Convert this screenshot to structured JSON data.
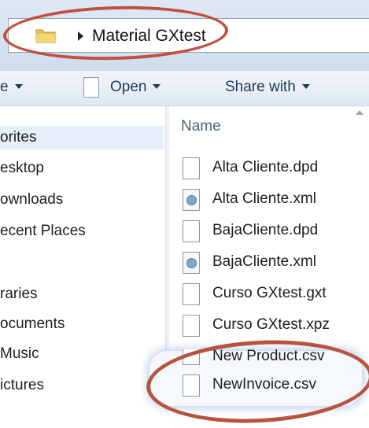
{
  "address_bar": {
    "breadcrumb": "Material GXtest"
  },
  "toolbar": {
    "organize_label": "e",
    "open_label": "Open",
    "share_label": "Share with"
  },
  "nav": {
    "items": [
      {
        "label": "orites"
      },
      {
        "label": "esktop"
      },
      {
        "label": "ownloads"
      },
      {
        "label": "ecent Places"
      },
      {
        "label": "raries"
      },
      {
        "label": "ocuments"
      },
      {
        "label": "Music"
      },
      {
        "label": "ictures"
      }
    ]
  },
  "file_list": {
    "column_name": "Name",
    "files": [
      {
        "name": "Alta Cliente.dpd",
        "icon": "document-icon"
      },
      {
        "name": "Alta Cliente.xml",
        "icon": "xml-file-icon"
      },
      {
        "name": "BajaCliente.dpd",
        "icon": "document-icon"
      },
      {
        "name": "BajaCliente.xml",
        "icon": "xml-file-icon"
      },
      {
        "name": "Curso GXtest.gxt",
        "icon": "document-icon"
      },
      {
        "name": "Curso GXtest.xpz",
        "icon": "document-icon"
      },
      {
        "name": "New Product.csv",
        "icon": "document-icon"
      },
      {
        "name": "NewInvoice.csv",
        "icon": "document-icon"
      }
    ]
  },
  "colors": {
    "annotation_ring": "#c2503e",
    "toolbar_text": "#1e395b"
  }
}
